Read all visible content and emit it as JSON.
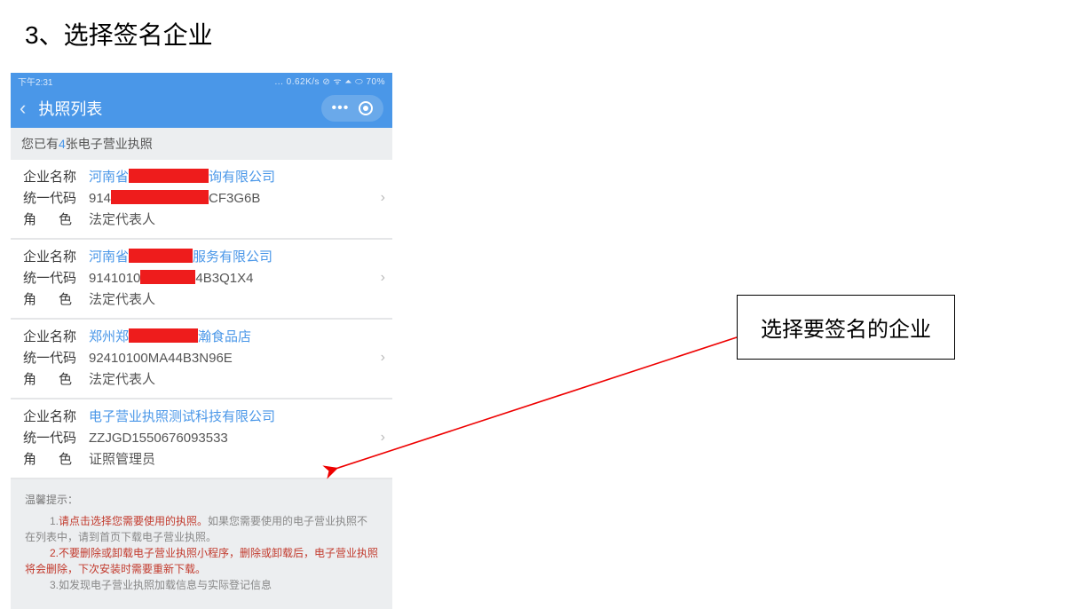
{
  "doc": {
    "heading": "3、选择签名企业"
  },
  "status": {
    "time": "下午2:31",
    "right": "... 0.62K/s ⊘ ᯤ ⏶ ⬭ 70%"
  },
  "titlebar": {
    "title": "执照列表"
  },
  "banner": {
    "prefix": "您已有",
    "count": "4",
    "suffix": "张电子营业执照"
  },
  "labels": {
    "name": "企业名称",
    "code": "统一代码",
    "role_a": "角",
    "role_b": "色"
  },
  "companies": [
    {
      "name_pre": "河南省",
      "name_post": "询有限公司",
      "code_pre": "914",
      "code_post": "CF3G6B",
      "role": "法定代表人",
      "redact_name_w": 90,
      "redact_code_w": 110
    },
    {
      "name_pre": "河南省",
      "name_post": "服务有限公司",
      "code_pre": "9141010",
      "code_post": "4B3Q1X4",
      "role": "法定代表人",
      "redact_name_w": 72,
      "redact_code_w": 62
    },
    {
      "name_pre": "郑州郑",
      "name_post": "瀚食品店",
      "code_pre": "92410100MA44B3N96E",
      "code_post": "",
      "role": "法定代表人",
      "redact_name_w": 78,
      "redact_code_w": 0
    },
    {
      "name_full": "电子营业执照测试科技有限公司",
      "code_full": "ZZJGD1550676093533",
      "role": "证照管理员"
    }
  ],
  "tips": {
    "title": "温馨提示：",
    "l1a": "1.",
    "l1b": "请点击选择您需要使用的执照。",
    "l1c": "如果您需要使用的电子营业执照不在列表中，请到首页下载电子营业执照。",
    "l2a": "2.不要删除或卸载电子营业执照小程序，删除或卸载后，电子营业执照将会删除，下次安装时需要重新下载。",
    "l3a": "3.如发现电子营业执照加载信息与实际登记信息"
  },
  "annotation": {
    "text": "选择要签名的企业"
  }
}
